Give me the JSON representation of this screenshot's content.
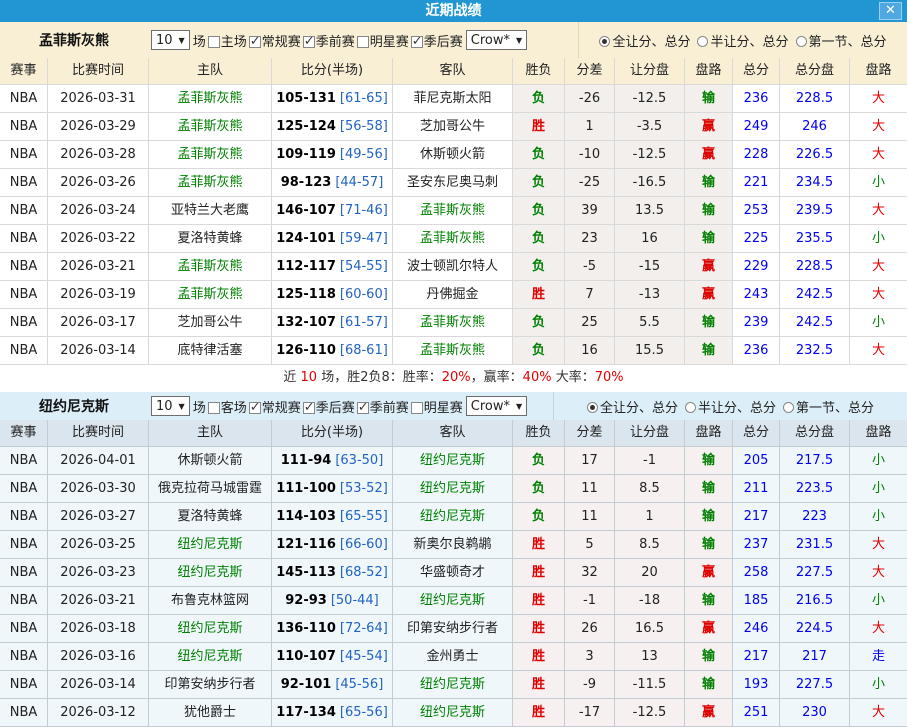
{
  "ui": {
    "select_arrow": "▼"
  },
  "title_bar": {
    "title": "近期战绩",
    "close_label": "✕"
  },
  "colors": {
    "red": "#e00000",
    "green": "#008000",
    "blue": "#0000ee",
    "half_blue": "#2163c2",
    "titlebar": "#2196d3"
  },
  "columns": [
    "赛事",
    "比赛时间",
    "主队",
    "比分(半场)",
    "客队",
    "胜负",
    "分差",
    "让分盘",
    "盘路",
    "总分",
    "总分盘",
    "盘路"
  ],
  "sections": [
    {
      "team": "孟菲斯灰熊",
      "games_count": "10",
      "games_unit": "场",
      "filters": [
        {
          "label": "主场",
          "checked": false
        },
        {
          "label": "常规赛",
          "checked": true
        },
        {
          "label": "季前赛",
          "checked": true
        },
        {
          "label": "明星赛",
          "checked": false
        },
        {
          "label": "季后赛",
          "checked": true
        }
      ],
      "source": "Crow*",
      "radios": [
        {
          "label": "全让分、总分",
          "selected": true
        },
        {
          "label": "半让分、总分",
          "selected": false
        },
        {
          "label": "第一节、总分",
          "selected": false
        }
      ],
      "rows": [
        {
          "league": "NBA",
          "date": "2026-03-31",
          "home": "孟菲斯灰熊",
          "home_focus": true,
          "score": "105-131",
          "half": "[61-65]",
          "away": "菲尼克斯太阳",
          "away_focus": false,
          "result": "负",
          "diff": "-26",
          "handicap": "-12.5",
          "handicap_result": "输",
          "total": "236",
          "total_line": "228.5",
          "ou": "大"
        },
        {
          "league": "NBA",
          "date": "2026-03-29",
          "home": "孟菲斯灰熊",
          "home_focus": true,
          "score": "125-124",
          "half": "[56-58]",
          "away": "芝加哥公牛",
          "away_focus": false,
          "result": "胜",
          "diff": "1",
          "handicap": "-3.5",
          "handicap_result": "赢",
          "total": "249",
          "total_line": "246",
          "ou": "大"
        },
        {
          "league": "NBA",
          "date": "2026-03-28",
          "home": "孟菲斯灰熊",
          "home_focus": true,
          "score": "109-119",
          "half": "[49-56]",
          "away": "休斯顿火箭",
          "away_focus": false,
          "result": "负",
          "diff": "-10",
          "handicap": "-12.5",
          "handicap_result": "赢",
          "total": "228",
          "total_line": "226.5",
          "ou": "大"
        },
        {
          "league": "NBA",
          "date": "2026-03-26",
          "home": "孟菲斯灰熊",
          "home_focus": true,
          "score": "98-123",
          "half": "[44-57]",
          "away": "圣安东尼奥马刺",
          "away_focus": false,
          "result": "负",
          "diff": "-25",
          "handicap": "-16.5",
          "handicap_result": "输",
          "total": "221",
          "total_line": "234.5",
          "ou": "小"
        },
        {
          "league": "NBA",
          "date": "2026-03-24",
          "home": "亚特兰大老鹰",
          "home_focus": false,
          "score": "146-107",
          "half": "[71-46]",
          "away": "孟菲斯灰熊",
          "away_focus": true,
          "result": "负",
          "diff": "39",
          "handicap": "13.5",
          "handicap_result": "输",
          "total": "253",
          "total_line": "239.5",
          "ou": "大"
        },
        {
          "league": "NBA",
          "date": "2026-03-22",
          "home": "夏洛特黄蜂",
          "home_focus": false,
          "score": "124-101",
          "half": "[59-47]",
          "away": "孟菲斯灰熊",
          "away_focus": true,
          "result": "负",
          "diff": "23",
          "handicap": "16",
          "handicap_result": "输",
          "total": "225",
          "total_line": "235.5",
          "ou": "小"
        },
        {
          "league": "NBA",
          "date": "2026-03-21",
          "home": "孟菲斯灰熊",
          "home_focus": true,
          "score": "112-117",
          "half": "[54-55]",
          "away": "波士顿凯尔特人",
          "away_focus": false,
          "result": "负",
          "diff": "-5",
          "handicap": "-15",
          "handicap_result": "赢",
          "total": "229",
          "total_line": "228.5",
          "ou": "大"
        },
        {
          "league": "NBA",
          "date": "2026-03-19",
          "home": "孟菲斯灰熊",
          "home_focus": true,
          "score": "125-118",
          "half": "[60-60]",
          "away": "丹佛掘金",
          "away_focus": false,
          "result": "胜",
          "diff": "7",
          "handicap": "-13",
          "handicap_result": "赢",
          "total": "243",
          "total_line": "242.5",
          "ou": "大"
        },
        {
          "league": "NBA",
          "date": "2026-03-17",
          "home": "芝加哥公牛",
          "home_focus": false,
          "score": "132-107",
          "half": "[61-57]",
          "away": "孟菲斯灰熊",
          "away_focus": true,
          "result": "负",
          "diff": "25",
          "handicap": "5.5",
          "handicap_result": "输",
          "total": "239",
          "total_line": "242.5",
          "ou": "小"
        },
        {
          "league": "NBA",
          "date": "2026-03-14",
          "home": "底特律活塞",
          "home_focus": false,
          "score": "126-110",
          "half": "[68-61]",
          "away": "孟菲斯灰熊",
          "away_focus": true,
          "result": "负",
          "diff": "16",
          "handicap": "15.5",
          "handicap_result": "输",
          "total": "236",
          "total_line": "232.5",
          "ou": "大"
        }
      ],
      "summary": [
        {
          "text": "近 ",
          "red": false
        },
        {
          "text": "10",
          "red": true
        },
        {
          "text": " 场，胜2负8：胜率：",
          "red": false
        },
        {
          "text": "20%",
          "red": true
        },
        {
          "text": "，赢率：",
          "red": false
        },
        {
          "text": "40%",
          "red": true
        },
        {
          "text": " 大率：",
          "red": false
        },
        {
          "text": "70%",
          "red": true
        }
      ]
    },
    {
      "team": "纽约尼克斯",
      "games_count": "10",
      "games_unit": "场",
      "filters": [
        {
          "label": "客场",
          "checked": false
        },
        {
          "label": "常规赛",
          "checked": true
        },
        {
          "label": "季后赛",
          "checked": true
        },
        {
          "label": "季前赛",
          "checked": true
        },
        {
          "label": "明星赛",
          "checked": false
        }
      ],
      "source": "Crow*",
      "radios": [
        {
          "label": "全让分、总分",
          "selected": true
        },
        {
          "label": "半让分、总分",
          "selected": false
        },
        {
          "label": "第一节、总分",
          "selected": false
        }
      ],
      "rows": [
        {
          "league": "NBA",
          "date": "2026-04-01",
          "home": "休斯顿火箭",
          "home_focus": false,
          "score": "111-94",
          "half": "[63-50]",
          "away": "纽约尼克斯",
          "away_focus": true,
          "result": "负",
          "diff": "17",
          "handicap": "-1",
          "handicap_result": "输",
          "total": "205",
          "total_line": "217.5",
          "ou": "小"
        },
        {
          "league": "NBA",
          "date": "2026-03-30",
          "home": "俄克拉荷马城雷霆",
          "home_focus": false,
          "score": "111-100",
          "half": "[53-52]",
          "away": "纽约尼克斯",
          "away_focus": true,
          "result": "负",
          "diff": "11",
          "handicap": "8.5",
          "handicap_result": "输",
          "total": "211",
          "total_line": "223.5",
          "ou": "小"
        },
        {
          "league": "NBA",
          "date": "2026-03-27",
          "home": "夏洛特黄蜂",
          "home_focus": false,
          "score": "114-103",
          "half": "[65-55]",
          "away": "纽约尼克斯",
          "away_focus": true,
          "result": "负",
          "diff": "11",
          "handicap": "1",
          "handicap_result": "输",
          "total": "217",
          "total_line": "223",
          "ou": "小"
        },
        {
          "league": "NBA",
          "date": "2026-03-25",
          "home": "纽约尼克斯",
          "home_focus": true,
          "score": "121-116",
          "half": "[66-60]",
          "away": "新奥尔良鹈鹕",
          "away_focus": false,
          "result": "胜",
          "diff": "5",
          "handicap": "8.5",
          "handicap_result": "输",
          "total": "237",
          "total_line": "231.5",
          "ou": "大"
        },
        {
          "league": "NBA",
          "date": "2026-03-23",
          "home": "纽约尼克斯",
          "home_focus": true,
          "score": "145-113",
          "half": "[68-52]",
          "away": "华盛顿奇才",
          "away_focus": false,
          "result": "胜",
          "diff": "32",
          "handicap": "20",
          "handicap_result": "赢",
          "total": "258",
          "total_line": "227.5",
          "ou": "大"
        },
        {
          "league": "NBA",
          "date": "2026-03-21",
          "home": "布鲁克林篮网",
          "home_focus": false,
          "score": "92-93",
          "half": "[50-44]",
          "away": "纽约尼克斯",
          "away_focus": true,
          "result": "胜",
          "diff": "-1",
          "handicap": "-18",
          "handicap_result": "输",
          "total": "185",
          "total_line": "216.5",
          "ou": "小"
        },
        {
          "league": "NBA",
          "date": "2026-03-18",
          "home": "纽约尼克斯",
          "home_focus": true,
          "score": "136-110",
          "half": "[72-64]",
          "away": "印第安纳步行者",
          "away_focus": false,
          "result": "胜",
          "diff": "26",
          "handicap": "16.5",
          "handicap_result": "赢",
          "total": "246",
          "total_line": "224.5",
          "ou": "大"
        },
        {
          "league": "NBA",
          "date": "2026-03-16",
          "home": "纽约尼克斯",
          "home_focus": true,
          "score": "110-107",
          "half": "[45-54]",
          "away": "金州勇士",
          "away_focus": false,
          "result": "胜",
          "diff": "3",
          "handicap": "13",
          "handicap_result": "输",
          "total": "217",
          "total_line": "217",
          "ou": "走"
        },
        {
          "league": "NBA",
          "date": "2026-03-14",
          "home": "印第安纳步行者",
          "home_focus": false,
          "score": "92-101",
          "half": "[45-56]",
          "away": "纽约尼克斯",
          "away_focus": true,
          "result": "胜",
          "diff": "-9",
          "handicap": "-11.5",
          "handicap_result": "输",
          "total": "193",
          "total_line": "227.5",
          "ou": "小"
        },
        {
          "league": "NBA",
          "date": "2026-03-12",
          "home": "犹他爵士",
          "home_focus": false,
          "score": "117-134",
          "half": "[65-56]",
          "away": "纽约尼克斯",
          "away_focus": true,
          "result": "胜",
          "diff": "-17",
          "handicap": "-12.5",
          "handicap_result": "赢",
          "total": "251",
          "total_line": "230",
          "ou": "大"
        }
      ],
      "summary": []
    }
  ]
}
